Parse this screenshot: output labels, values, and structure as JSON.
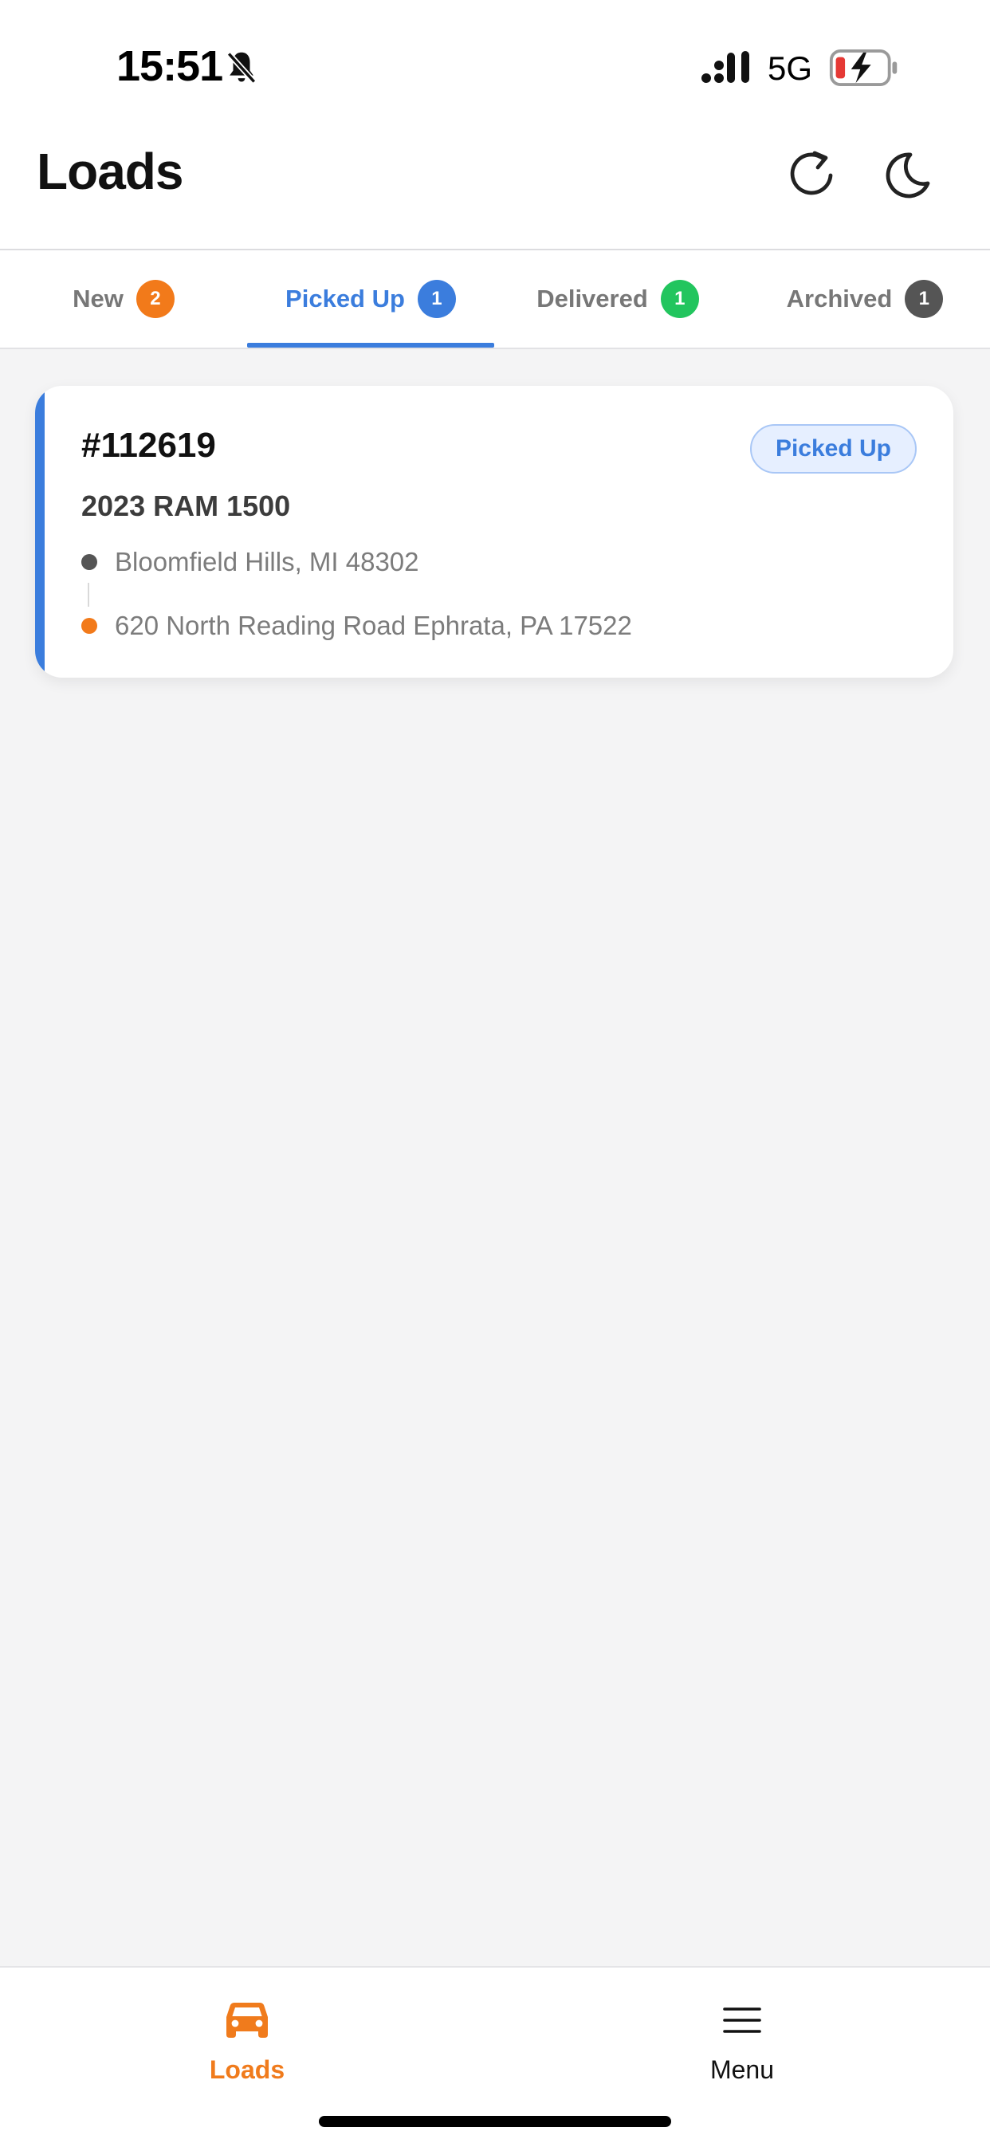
{
  "status_bar": {
    "time": "15:51",
    "network": "5G",
    "icons": [
      "bell-off-icon",
      "signal-icon",
      "battery-charging-icon"
    ],
    "colors": {
      "battery_low": "#e53935"
    }
  },
  "header": {
    "title": "Loads",
    "icons": [
      "refresh-icon",
      "moon-icon"
    ]
  },
  "tabs": [
    {
      "label": "New",
      "count": "2",
      "color": "#f27a1a",
      "active": false
    },
    {
      "label": "Picked Up",
      "count": "1",
      "color": "#3b7ddd",
      "active": true
    },
    {
      "label": "Delivered",
      "count": "1",
      "color": "#22c55e",
      "active": false
    },
    {
      "label": "Archived",
      "count": "1",
      "color": "#555555",
      "active": false
    }
  ],
  "loads": [
    {
      "number": "#112619",
      "status": "Picked Up",
      "vehicle": "2023 RAM 1500",
      "origin": "Bloomfield Hills, MI 48302",
      "destination": "620 North Reading Road Ephrata, PA 17522",
      "accent_color": "#3b7ddd"
    }
  ],
  "bottom_nav": {
    "items": [
      {
        "label": "Loads",
        "icon": "car-icon",
        "active": true,
        "color": "#f07b1c"
      },
      {
        "label": "Menu",
        "icon": "hamburger-menu-icon",
        "active": false
      }
    ]
  }
}
